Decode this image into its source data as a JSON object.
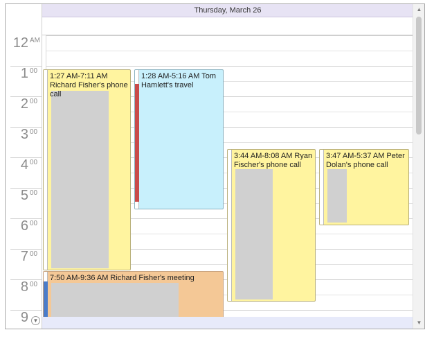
{
  "header": {
    "day_label": "Thursday, March 26"
  },
  "time_ruler": {
    "hours": [
      {
        "num": "12",
        "ampm": "AM"
      },
      {
        "num": "1",
        "ampm": "00"
      },
      {
        "num": "2",
        "ampm": "00"
      },
      {
        "num": "3",
        "ampm": "00"
      },
      {
        "num": "4",
        "ampm": "00"
      },
      {
        "num": "5",
        "ampm": "00"
      },
      {
        "num": "6",
        "ampm": "00"
      },
      {
        "num": "7",
        "ampm": "00"
      },
      {
        "num": "8",
        "ampm": "00"
      },
      {
        "num": "9",
        "ampm": ""
      }
    ]
  },
  "appointments": [
    {
      "text": "1:27 AM-7:11 AM Richard Fisher's phone call",
      "color": "#fff49f",
      "status_color": "#ffffff"
    },
    {
      "text": "1:28 AM-5:16 AM Tom Hamlett's travel",
      "color": "#c8f0fc",
      "status_color": "#c94a4a"
    },
    {
      "text": "3:44 AM-8:08 AM Ryan Fischer's phone call",
      "color": "#fff49f",
      "status_color": "#ffffff"
    },
    {
      "text": "3:47 AM-5:37 AM Peter Dolan's phone call",
      "color": "#fff49f",
      "status_color": "#ffffff"
    },
    {
      "text": "7:50 AM-9:36 AM Richard Fisher's meeting",
      "color": "#f4c896",
      "status_color": "#4a7cc9"
    }
  ],
  "icons": {
    "scroll_up": "triangle-up-icon",
    "scroll_down": "triangle-down-icon",
    "more": "chevron-down-circle-icon"
  }
}
